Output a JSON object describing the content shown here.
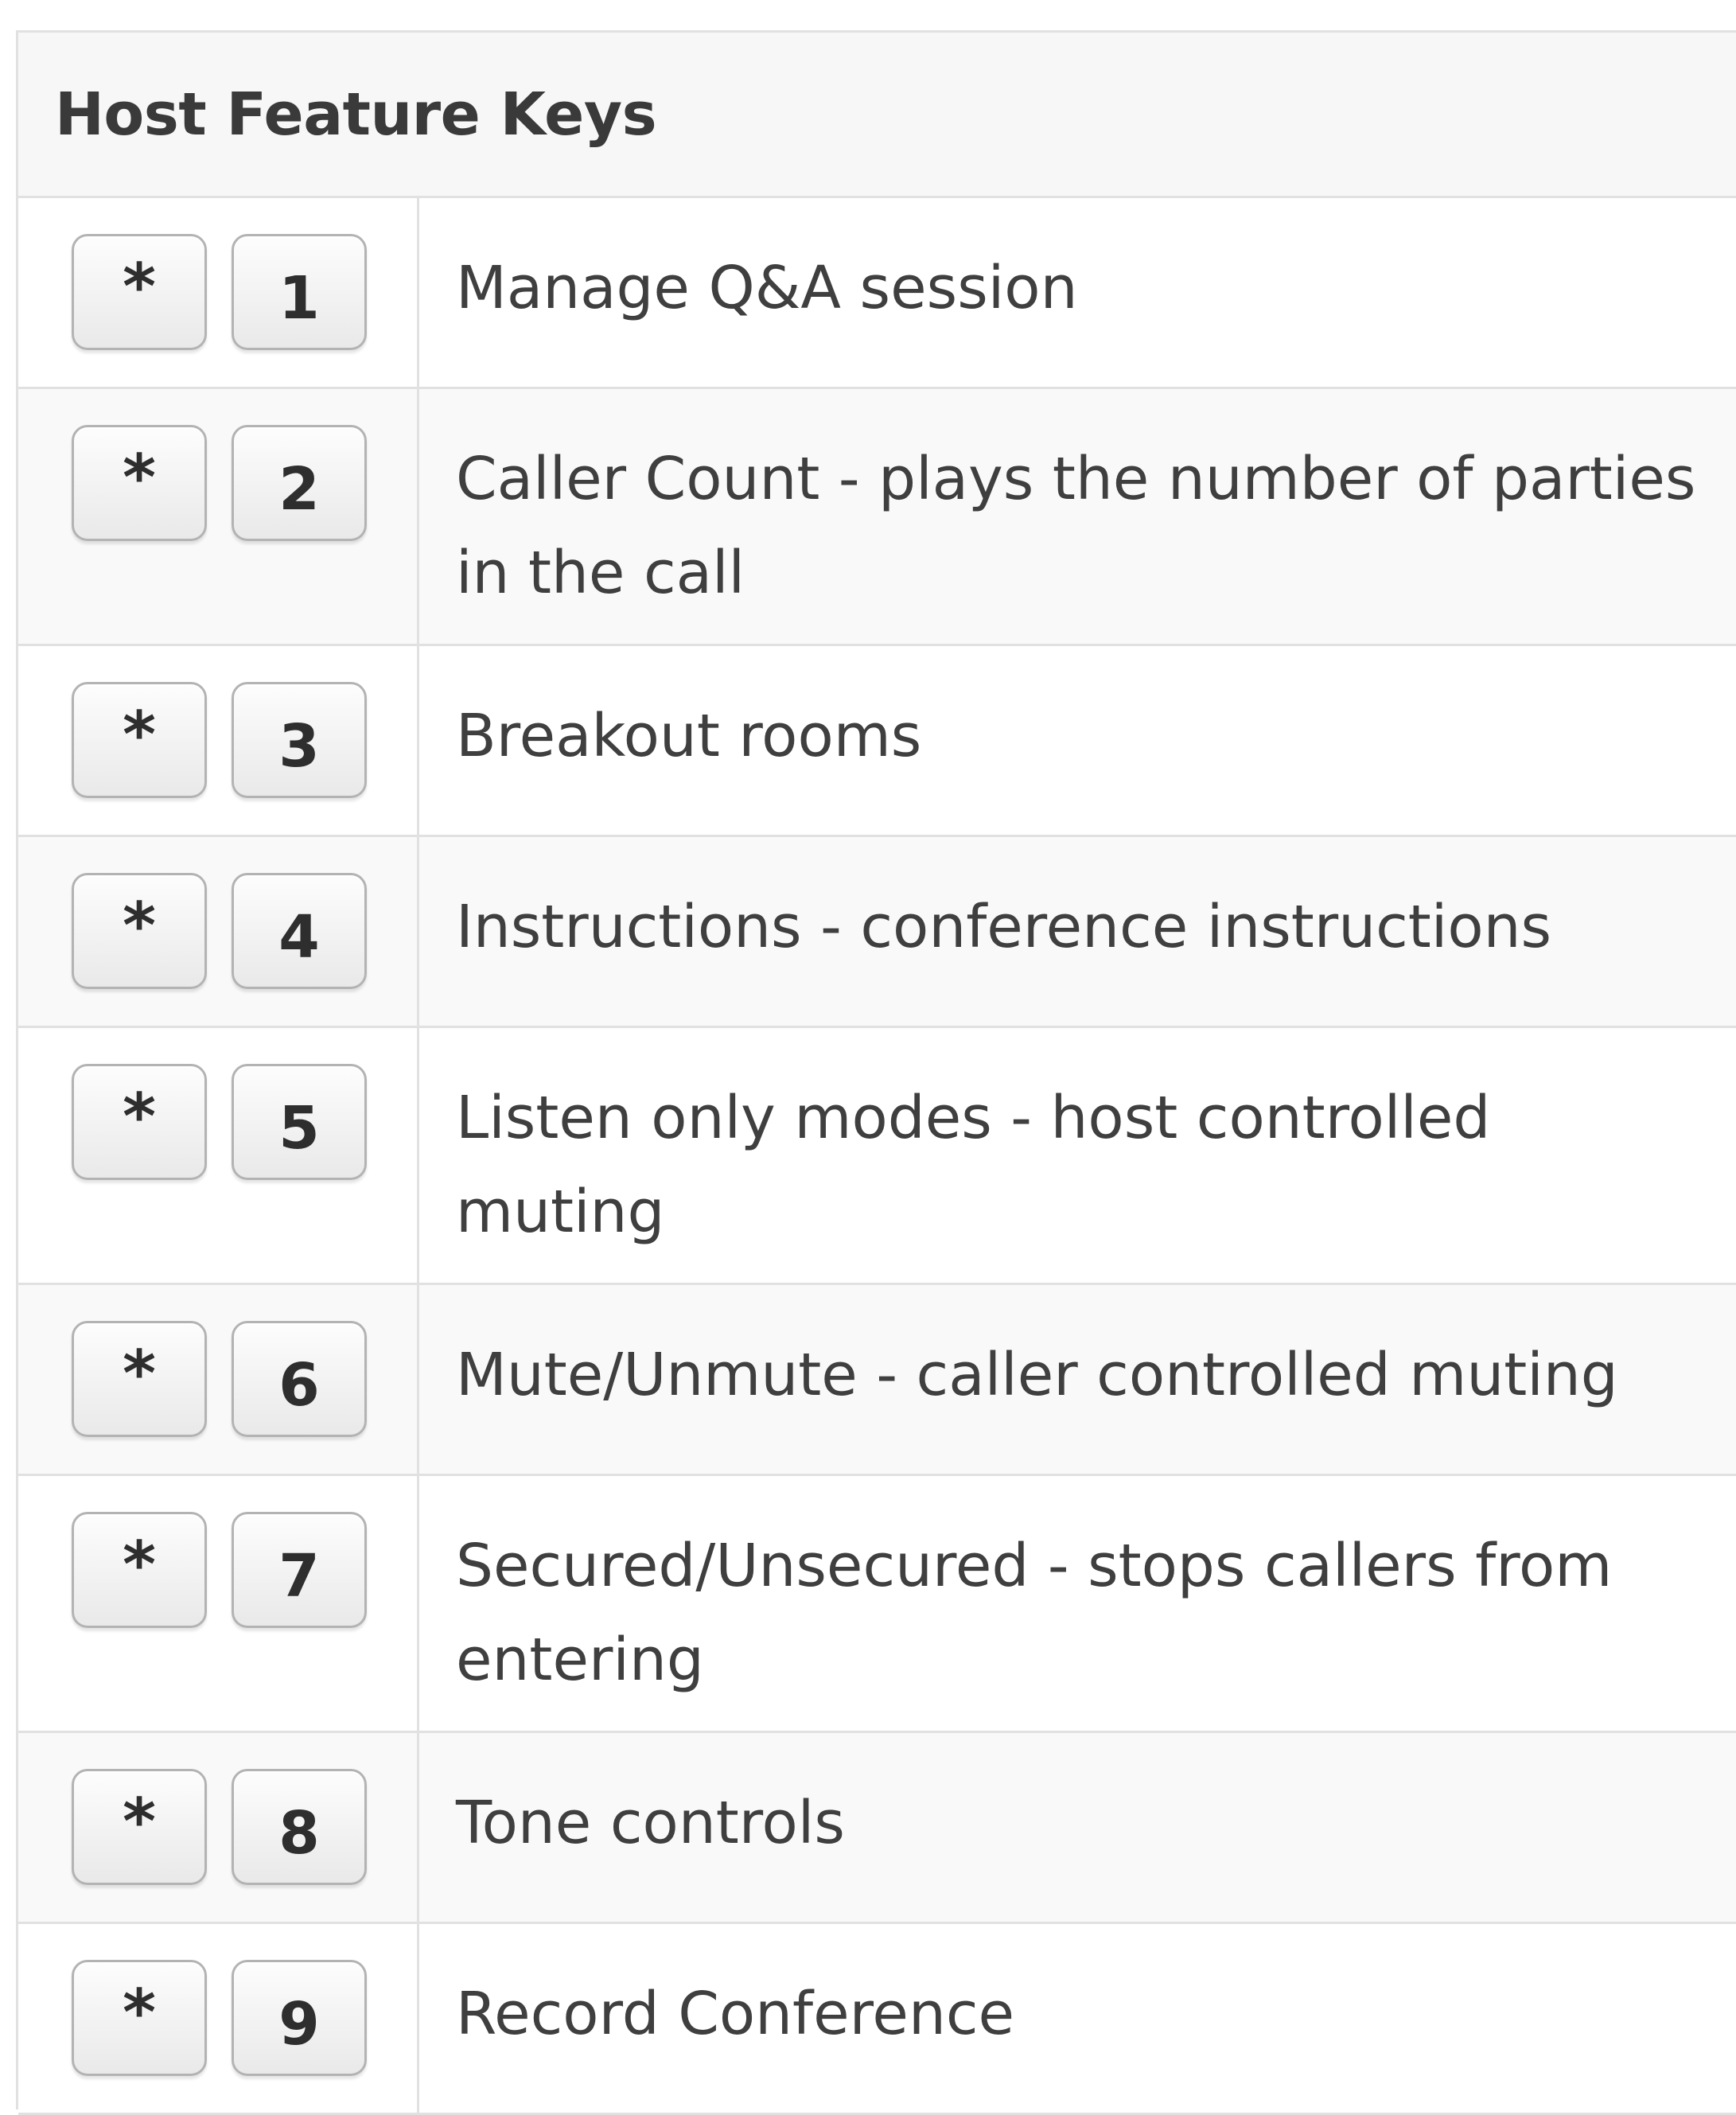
{
  "table": {
    "title": "Host Feature Keys",
    "rows": [
      {
        "prefix": "*",
        "key": "1",
        "description": "Manage Q&A session"
      },
      {
        "prefix": "*",
        "key": "2",
        "description": "Caller Count - plays the number of parties in the call"
      },
      {
        "prefix": "*",
        "key": "3",
        "description": "Breakout rooms"
      },
      {
        "prefix": "*",
        "key": "4",
        "description": "Instructions - conference instructions"
      },
      {
        "prefix": "*",
        "key": "5",
        "description": "Listen only modes - host controlled muting"
      },
      {
        "prefix": "*",
        "key": "6",
        "description": "Mute/Unmute - caller controlled muting"
      },
      {
        "prefix": "*",
        "key": "7",
        "description": "Secured/Unsecured - stops callers from entering"
      },
      {
        "prefix": "*",
        "key": "8",
        "description": "Tone controls"
      },
      {
        "prefix": "*",
        "key": "9",
        "description": "Record Conference"
      }
    ]
  }
}
